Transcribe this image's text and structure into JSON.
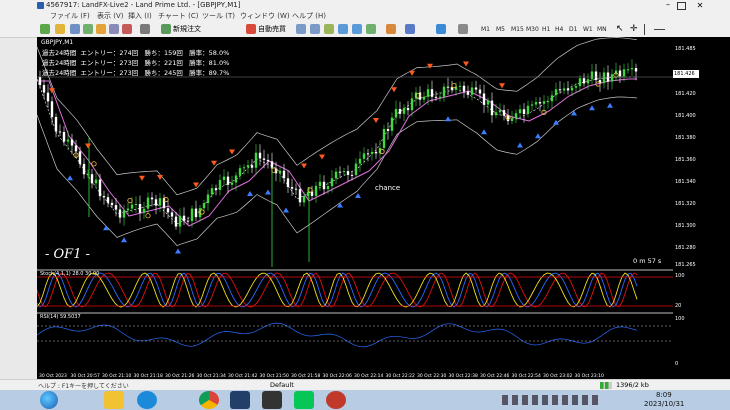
{
  "window": {
    "title": "4567917: LandFX-Live2 - Land Prime Ltd. - [GBPJPY,M1]"
  },
  "menu": [
    "ファイル (F)",
    "表示 (V)",
    "挿入 (I)",
    "チャート (C)",
    "ツール (T)",
    "ウィンドウ (W)",
    "ヘルプ (H)"
  ],
  "toolbar": {
    "new_order": "新規注文",
    "auto_trade": "自動売買",
    "timeframes": [
      "M1",
      "M5",
      "M15",
      "M30",
      "H1",
      "H4",
      "D1",
      "W1",
      "MN"
    ]
  },
  "chart": {
    "symbol_label": "GBPJPY,M1",
    "stats": [
      "過去24時間  エントリー：274回   勝ち：159回   勝率：58.0%",
      "過去24時間  エントリー：273回   勝ち：221回   勝率：81.0%",
      "過去24時間  エントリー：273回   勝ち：245回   勝率：89.7%"
    ],
    "watermark": "- OF1 -",
    "chance_label": "chance",
    "countdown": "0 m 57 s",
    "price_ticks": [
      "181.485",
      "181.420",
      "181.400",
      "181.380",
      "181.360",
      "181.340",
      "181.320",
      "181.300",
      "181.280",
      "181.265"
    ],
    "current_price": "181.426",
    "stoch_label": "Stoch(4,1,1) 28.0  30.00",
    "stoch_ticks": [
      "100",
      "20"
    ],
    "rsi_label": "RSI(14) 59.5037",
    "rsi_ticks": [
      "100",
      "0"
    ],
    "time_ticks": [
      "30 Oct 2023",
      "30 Oct 20:57",
      "30 Oct 21:10",
      "30 Oct 21:18",
      "30 Oct 21:26",
      "30 Oct 21:34",
      "30 Oct 21:42",
      "30 Oct 21:50",
      "30 Oct 21:58",
      "30 Oct 22:06",
      "30 Oct 22:14",
      "30 Oct 22:22",
      "30 Oct 22:30",
      "30 Oct 22:38",
      "30 Oct 22:46",
      "30 Oct 22:54",
      "30 Oct 23:02",
      "30 Oct 23:10"
    ]
  },
  "statusbar": {
    "left_text": "ヘルプ : F1キーを押してください",
    "profile": "Default",
    "traffic": "1396/2 kb"
  },
  "taskbar": {
    "clock_time": "8:09",
    "clock_date": "2023/10/31"
  },
  "colors": {
    "bull_candle": "#3fd93f",
    "bear_candle": "#ffffff",
    "ma_magenta": "#e070e0",
    "band_line": "#c8c8c8",
    "sell_arrow": "#ff5a1e",
    "buy_arrow": "#3d7bff",
    "stoch_red": "#e01010",
    "stoch_blue": "#2a6bff",
    "stoch_yellow": "#f0e020"
  },
  "icons": [
    "windows-start-icon",
    "explorer-icon",
    "edge-icon",
    "chrome-icon",
    "metatrader-icon",
    "line-icon",
    "taskbar-app-icon"
  ]
}
